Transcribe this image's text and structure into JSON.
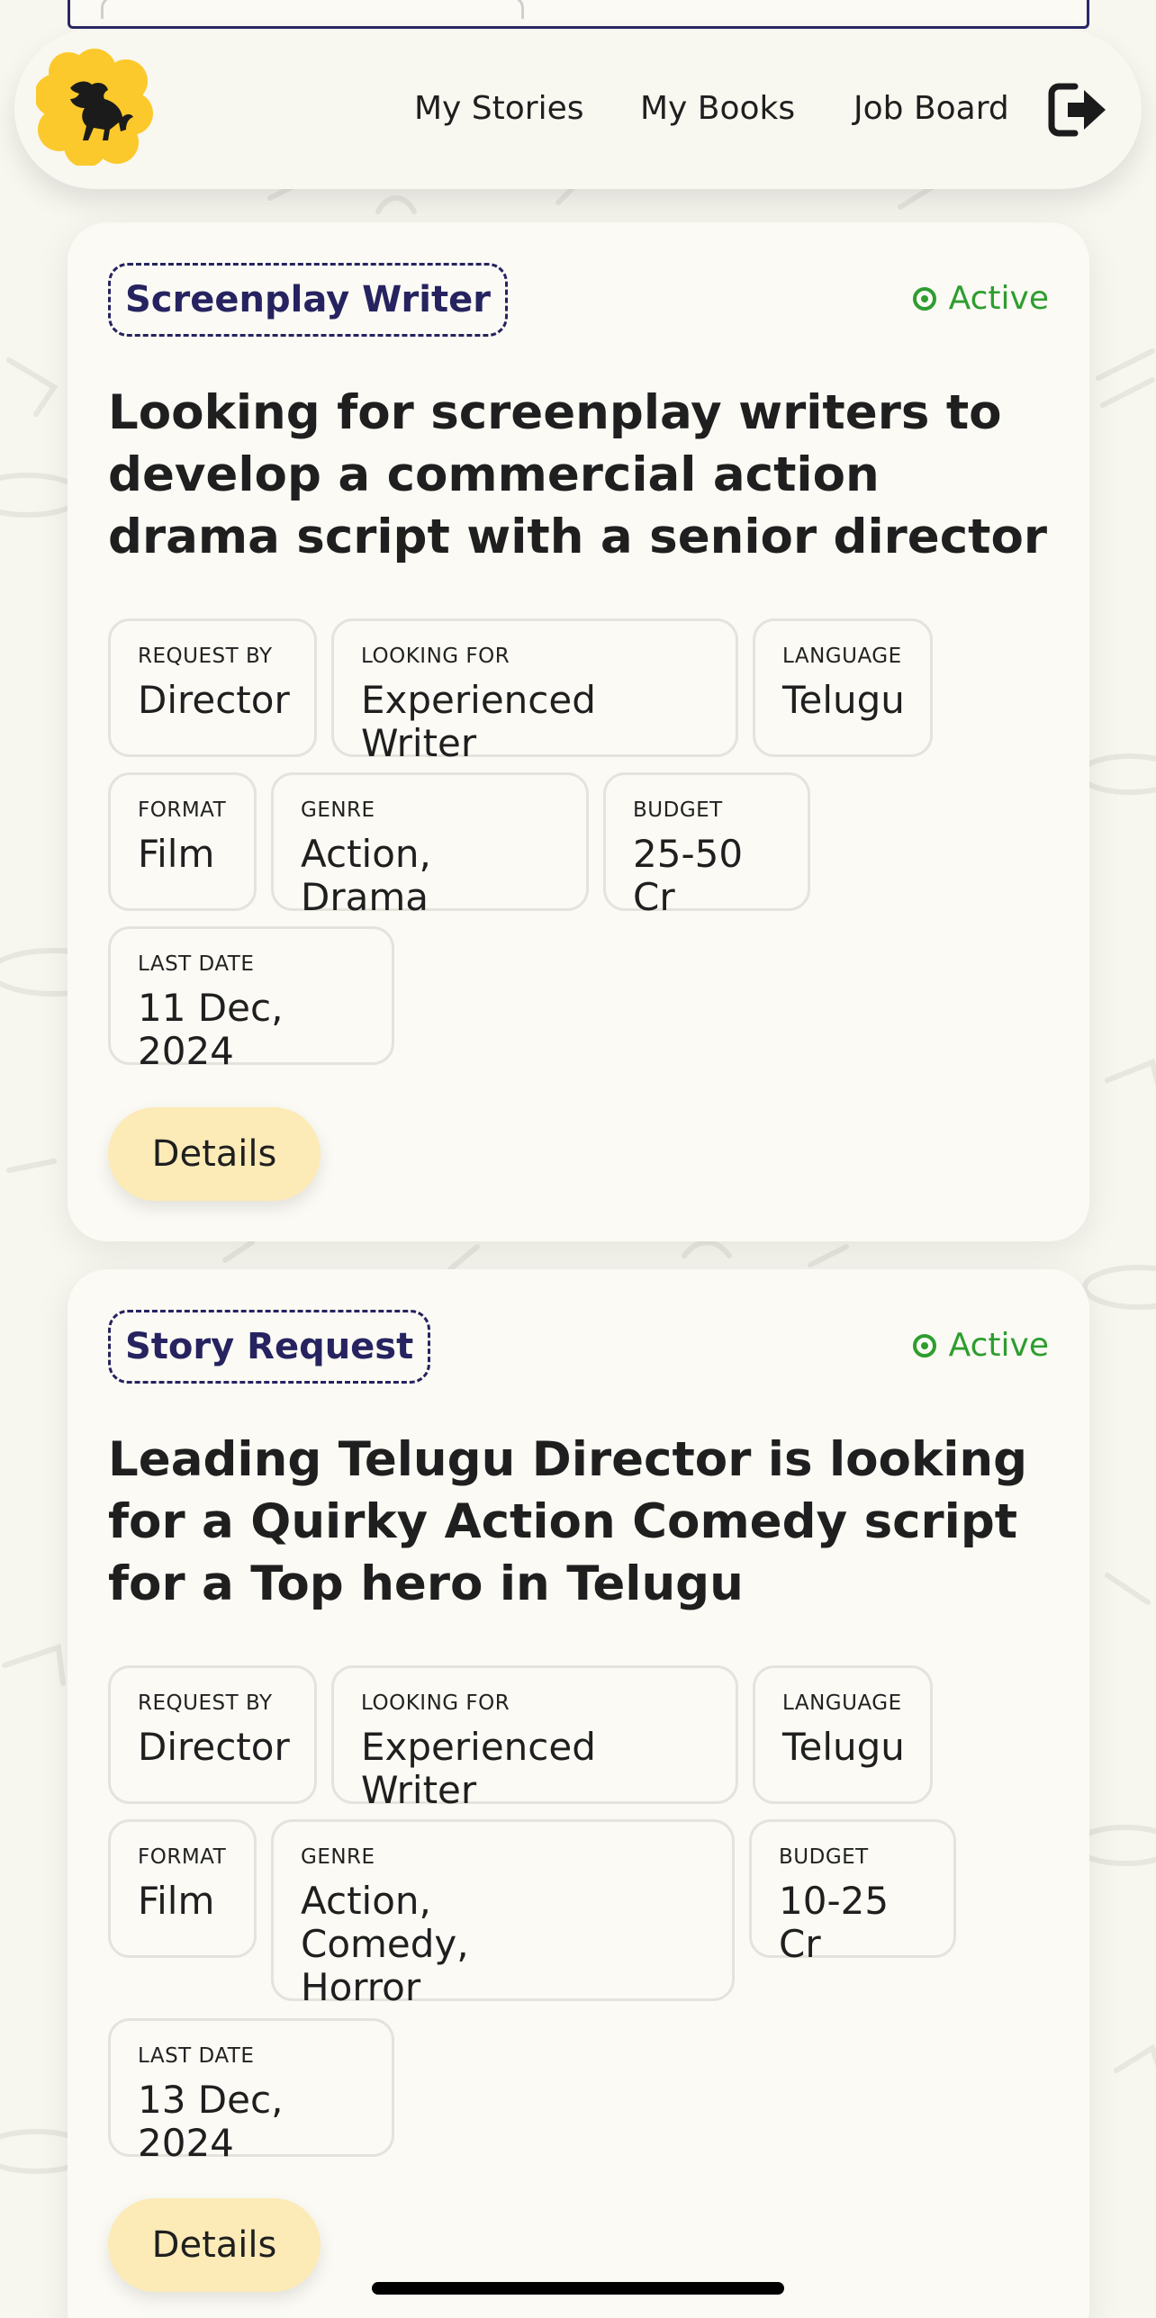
{
  "header": {
    "nav": [
      "My Stories",
      "My Books",
      "Job Board"
    ],
    "logo_icon": "lion-logo-icon",
    "logout_icon": "logout-icon"
  },
  "colors": {
    "accent_yellow": "#fbc92c",
    "tag_navy": "#262360",
    "status_green": "#2e9d2f",
    "button_bg": "#fcebb7"
  },
  "cards": [
    {
      "tag": "Screenplay Writer",
      "status": "Active",
      "title": "Looking for screenplay writers to develop a commercial action drama script with a senior director",
      "fields": [
        {
          "label": "REQUEST BY",
          "value": "Director"
        },
        {
          "label": "LOOKING FOR",
          "value": "Experienced Writer"
        },
        {
          "label": "LANGUAGE",
          "value": "Telugu"
        },
        {
          "label": "FORMAT",
          "value": "Film"
        },
        {
          "label": "GENRE",
          "value": "Action, Drama"
        },
        {
          "label": "BUDGET",
          "value": "25-50 Cr"
        },
        {
          "label": "LAST DATE",
          "value": "11 Dec, 2024"
        }
      ],
      "button": "Details"
    },
    {
      "tag": "Story Request",
      "status": "Active",
      "title": "Leading Telugu Director is looking for a Quirky Action Comedy script for a Top hero in Telugu",
      "fields": [
        {
          "label": "REQUEST BY",
          "value": "Director"
        },
        {
          "label": "LOOKING FOR",
          "value": "Experienced Writer"
        },
        {
          "label": "LANGUAGE",
          "value": "Telugu"
        },
        {
          "label": "FORMAT",
          "value": "Film"
        },
        {
          "label": "GENRE",
          "value": "Action, Comedy, Horror"
        },
        {
          "label": "BUDGET",
          "value": "10-25 Cr"
        },
        {
          "label": "LAST DATE",
          "value": "13 Dec, 2024"
        }
      ],
      "button": "Details"
    }
  ]
}
